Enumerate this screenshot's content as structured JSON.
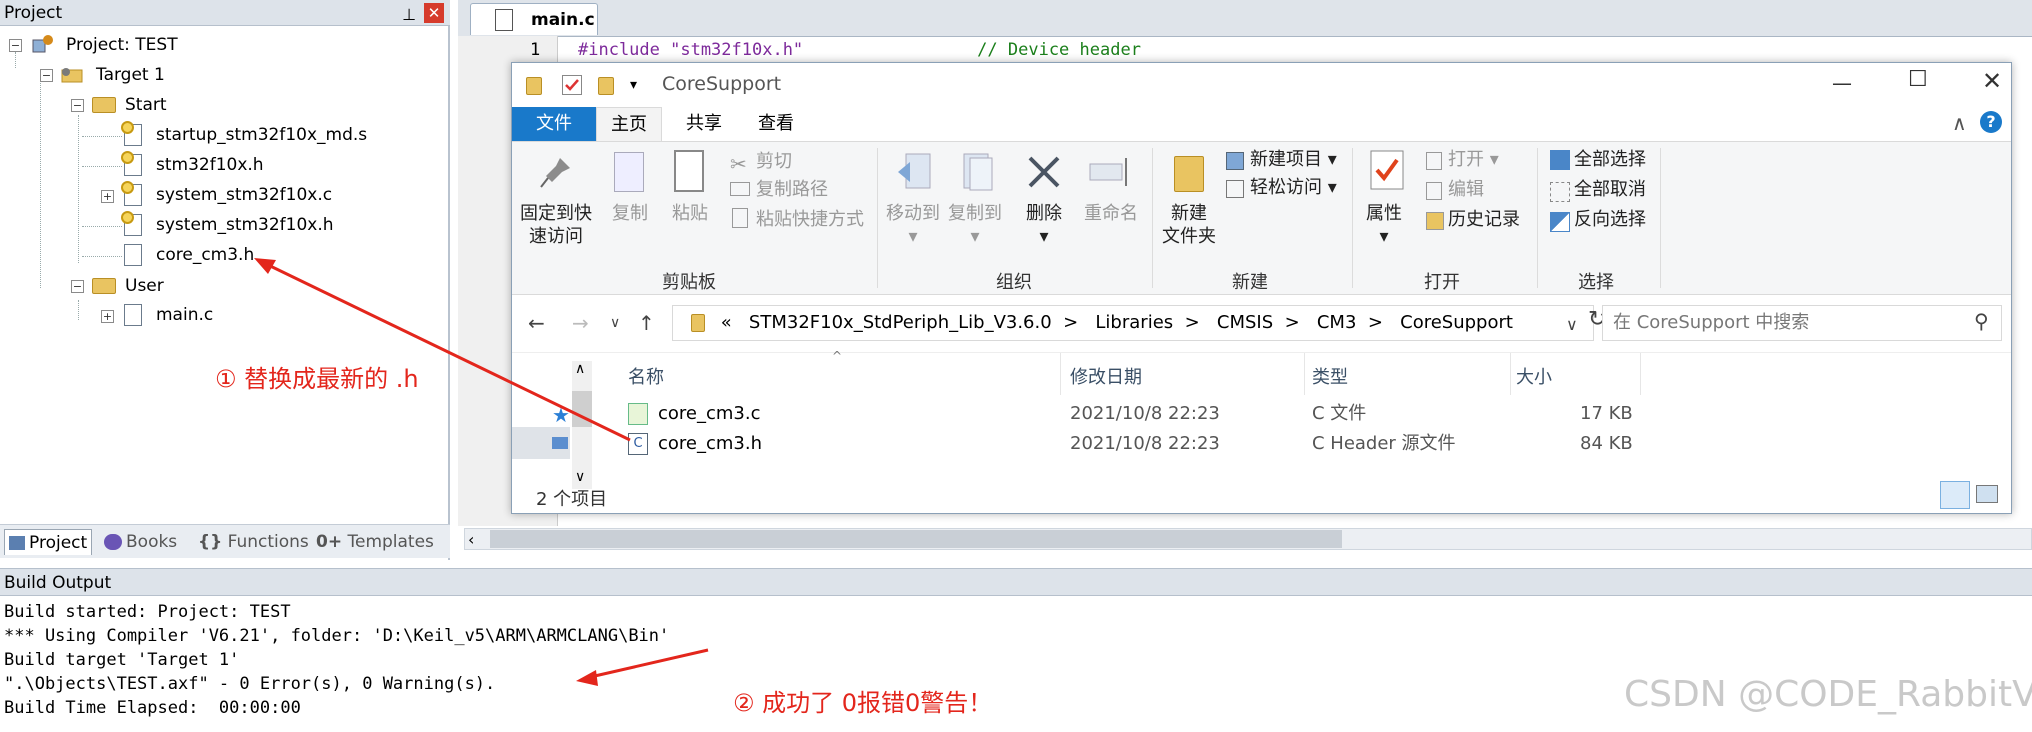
{
  "project_panel": {
    "title": "Project",
    "pin_glyph": "⊥",
    "close_glyph": "✕",
    "tree": {
      "project": "Project: TEST",
      "target": "Target 1",
      "group_start": "Start",
      "files_start": [
        "startup_stm32f10x_md.s",
        "stm32f10x.h",
        "system_stm32f10x.c",
        "system_stm32f10x.h",
        "core_cm3.h"
      ],
      "group_user": "User",
      "files_user": [
        "main.c"
      ]
    },
    "tabs": [
      "Project",
      "Books",
      "Functions",
      "Templates"
    ],
    "tab_prefixes": [
      "{}",
      "0+"
    ]
  },
  "annotations": {
    "step1": "① 替换成最新的 .h",
    "step2": "② 成功了 0报错0警告！"
  },
  "editor": {
    "tab": "main.c",
    "line_number": "1",
    "code_line": "#include \"stm32f10x.h\"",
    "code_comment": "// Device header"
  },
  "explorer": {
    "title": "CoreSupport",
    "ribbon_tabs": [
      "文件",
      "主页",
      "共享",
      "查看"
    ],
    "clipboard": {
      "pin_l1": "固定到快",
      "pin_l2": "速访问",
      "copy": "复制",
      "paste": "粘贴",
      "cut": "剪切",
      "copy_path": "复制路径",
      "paste_shortcut": "粘贴快捷方式",
      "group": "剪贴板"
    },
    "organize": {
      "move_to": "移动到",
      "copy_to": "复制到",
      "delete": "删除",
      "rename": "重命名",
      "group": "组织"
    },
    "new": {
      "new_folder_l1": "新建",
      "new_folder_l2": "文件夹",
      "new_item": "新建项目",
      "easy_access": "轻松访问",
      "group": "新建"
    },
    "open": {
      "properties": "属性",
      "open": "打开",
      "edit": "编辑",
      "history": "历史记录",
      "group": "打开"
    },
    "select": {
      "select_all": "全部选择",
      "select_none": "全部取消",
      "invert": "反向选择",
      "group": "选择"
    },
    "address": {
      "prefix": "«",
      "crumbs": [
        "STM32F10x_StdPeriph_Lib_V3.6.0",
        "Libraries",
        "CMSIS",
        "CM3",
        "CoreSupport"
      ],
      "sep": ">"
    },
    "search_placeholder": "在 CoreSupport 中搜索",
    "columns": [
      "名称",
      "修改日期",
      "类型",
      "大小"
    ],
    "rows": [
      {
        "name": "core_cm3.c",
        "date": "2021/10/8 22:23",
        "type": "C 文件",
        "size": "17 KB"
      },
      {
        "name": "core_cm3.h",
        "date": "2021/10/8 22:23",
        "type": "C Header 源文件",
        "size": "84 KB"
      }
    ],
    "status": "2 个项目"
  },
  "build_output": {
    "title": "Build Output",
    "lines": [
      "Build started: Project: TEST",
      "*** Using Compiler 'V6.21', folder: 'D:\\Keil_v5\\ARM\\ARMCLANG\\Bin'",
      "Build target 'Target 1'",
      "\".\\Objects\\TEST.axf\" - 0 Error(s), 0 Warning(s).",
      "Build Time Elapsed:  00:00:00"
    ]
  },
  "watermark": "CSDN @CODE_RabbitV",
  "colors": {
    "accent": "#1979ca",
    "annotation": "#e3261c"
  }
}
